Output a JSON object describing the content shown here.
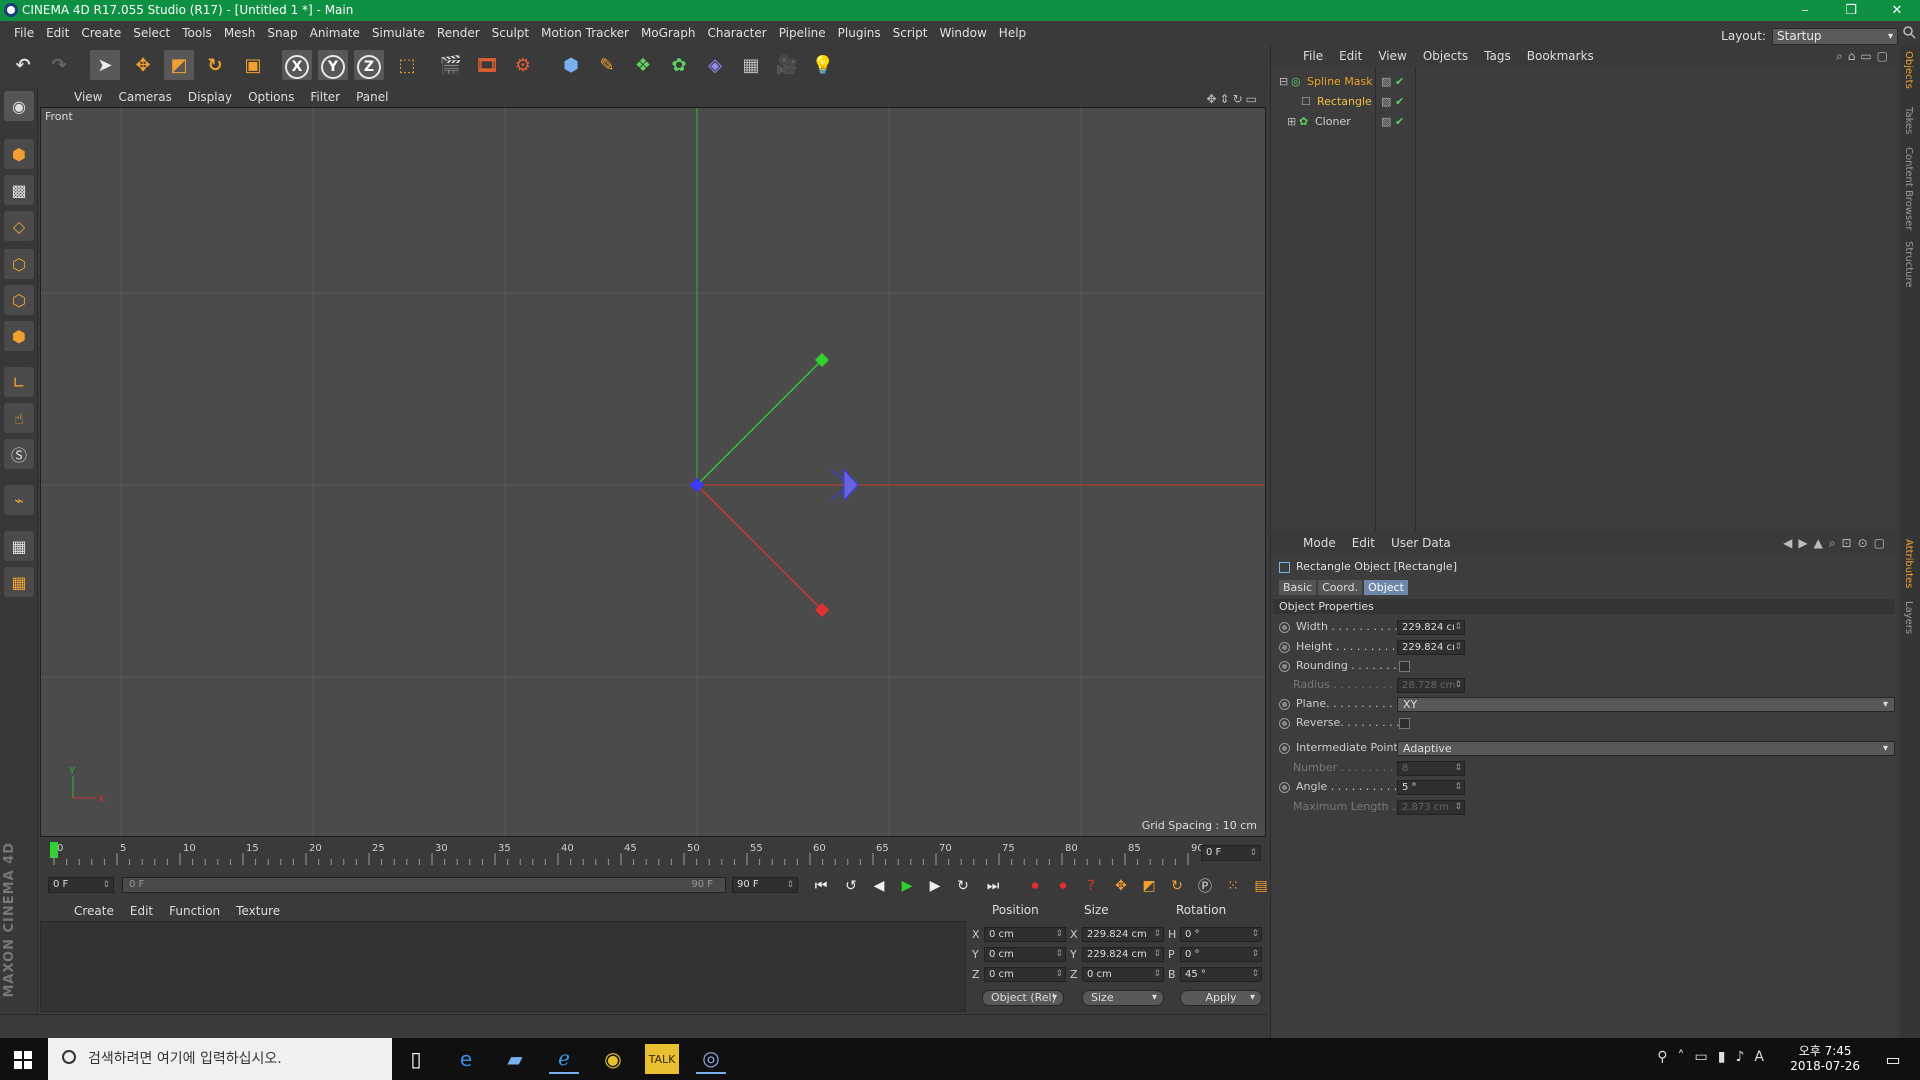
{
  "window": {
    "title": "CINEMA 4D R17.055 Studio (R17) - [Untitled 1 *] - Main",
    "controls": [
      "–",
      "❐",
      "✕"
    ]
  },
  "menubar": {
    "items": [
      "File",
      "Edit",
      "Create",
      "Select",
      "Tools",
      "Mesh",
      "Snap",
      "Animate",
      "Simulate",
      "Render",
      "Sculpt",
      "Motion Tracker",
      "MoGraph",
      "Character",
      "Pipeline",
      "Plugins",
      "Script",
      "Window",
      "Help"
    ],
    "layout_label": "Layout:",
    "layout_value": "Startup"
  },
  "viewport": {
    "menu": [
      "View",
      "Cameras",
      "Display",
      "Options",
      "Filter",
      "Panel"
    ],
    "camera": "Front",
    "grid_spacing": "Grid Spacing : 10 cm",
    "axis_y": "Y",
    "axis_x": "X",
    "colors": {
      "x_axis": "#c83232",
      "y_axis": "#32b432",
      "handle_blue": "#3a3aff",
      "grid": "#585858"
    }
  },
  "timeline": {
    "ticks": [
      "0",
      "5",
      "10",
      "15",
      "20",
      "25",
      "30",
      "35",
      "40",
      "45",
      "50",
      "55",
      "60",
      "65",
      "70",
      "75",
      "80",
      "85",
      "90"
    ],
    "current_frame": "0 F",
    "start_field": "0 F",
    "range_start": "0 F",
    "range_end": "90 F",
    "end_field": "90 F"
  },
  "materials": {
    "menu": [
      "Create",
      "Edit",
      "Function",
      "Texture"
    ]
  },
  "coordinates": {
    "headers": [
      "Position",
      "Size",
      "Rotation"
    ],
    "rows": [
      {
        "pl": "X",
        "pv": "0 cm",
        "sl": "X",
        "sv": "229.824 cm",
        "rl": "H",
        "rv": "0 °"
      },
      {
        "pl": "Y",
        "pv": "0 cm",
        "sl": "Y",
        "sv": "229.824 cm",
        "rl": "P",
        "rv": "0 °"
      },
      {
        "pl": "Z",
        "pv": "0 cm",
        "sl": "Z",
        "sv": "0 cm",
        "rl": "B",
        "rv": "45 °"
      }
    ],
    "mode": "Object (Rel)",
    "size_mode": "Size",
    "apply": "Apply"
  },
  "objects": {
    "menu": [
      "File",
      "Edit",
      "View",
      "Objects",
      "Tags",
      "Bookmarks"
    ],
    "items": [
      {
        "name": "Spline Mask",
        "color": "#e8a020"
      },
      {
        "name": "Rectangle",
        "color": "#f0c040"
      },
      {
        "name": "Cloner",
        "color": "#cfcfcf"
      }
    ]
  },
  "attributes": {
    "menu": [
      "Mode",
      "Edit",
      "User Data"
    ],
    "title": "Rectangle Object [Rectangle]",
    "tabs": [
      "Basic",
      "Coord.",
      "Object"
    ],
    "section": "Object Properties",
    "width_label": "Width . . . . . . . . . . . .",
    "width_value": "229.824 cı",
    "height_label": "Height . . . . . . . . . . .",
    "height_value": "229.824 cı",
    "rounding_label": "Rounding . . . . . . . .",
    "radius_label": "Radius . . . . . . . . . .",
    "radius_value": "28.728 cm",
    "plane_label": "Plane. . . . . . . . . . . .",
    "plane_value": "XY",
    "reverse_label": "Reverse. . . . . . . . . .",
    "intermediate_label": "Intermediate Points",
    "intermediate_value": "Adaptive",
    "number_label": "Number . . . . . . . . .",
    "number_value": "8",
    "angle_label": "Angle . . . . . . . . . . .",
    "angle_value": "5 °",
    "maxlen_label": "Maximum Length .",
    "maxlen_value": "2.873 cm"
  },
  "sidetabs": [
    "Objects",
    "Takes",
    "Content Browser",
    "Structure",
    "Attributes",
    "Layers"
  ],
  "taskbar": {
    "search_placeholder": "검색하려면 여기에 입력하십시오.",
    "time": "오후 7:45",
    "date": "2018-07-26",
    "ime": "A"
  },
  "logo": "MAXON CINEMA 4D"
}
